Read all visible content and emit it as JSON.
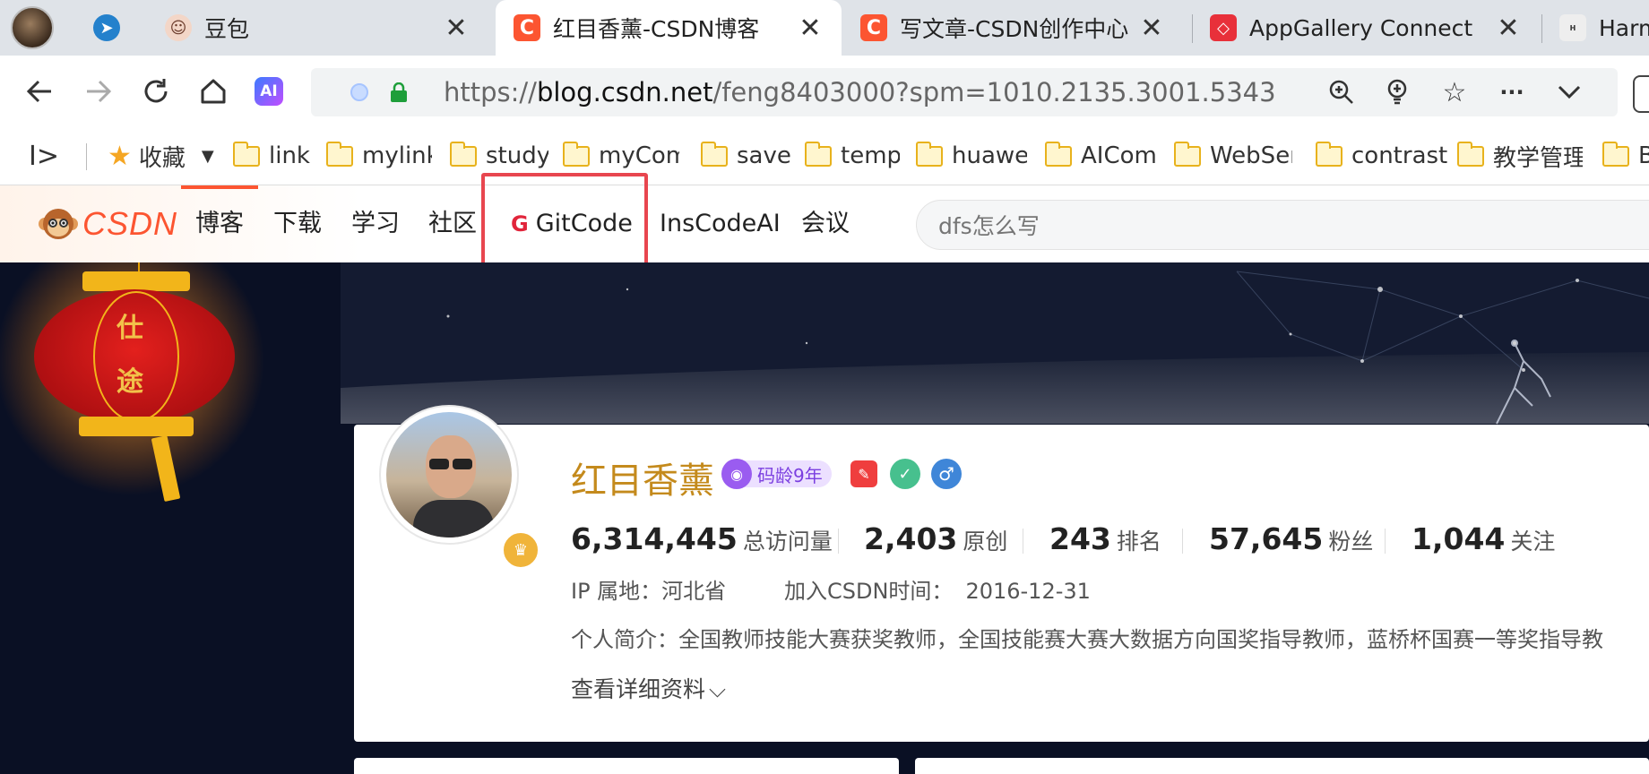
{
  "tabs": [
    {
      "title": "",
      "favicon": "profile-avatar-icon"
    },
    {
      "title": "",
      "favicon": "telegram-icon"
    },
    {
      "title": "豆包",
      "favicon": "doubao-icon"
    },
    {
      "title": "红目香薰-CSDN博客",
      "favicon": "csdn-icon",
      "active": true
    },
    {
      "title": "写文章-CSDN创作中心",
      "favicon": "csdn-icon"
    },
    {
      "title": "AppGallery Connect",
      "favicon": "appgallery-icon"
    },
    {
      "title": "Harm",
      "favicon": "harmonyos-icon"
    }
  ],
  "address_bar": {
    "scheme": "https://",
    "domain": "blog.csdn.net",
    "path": "/feng8403000?spm=1010.2135.3001.5343"
  },
  "bookmarks": {
    "favorites_label": "收藏",
    "items": [
      "link",
      "mylink",
      "study",
      "myCom",
      "save",
      "temp",
      "huawei",
      "AICom",
      "WebSer",
      "contrast",
      "教学管理",
      "B"
    ]
  },
  "csdn_nav": {
    "logo": "CSDN",
    "items": [
      "博客",
      "下载",
      "学习",
      "社区",
      "GitCode",
      "InsCodeAI",
      "会议"
    ],
    "search_placeholder": "dfs怎么写"
  },
  "lantern_text": [
    "仕",
    "途"
  ],
  "profile": {
    "name": "红目香薰",
    "code_age_badge": "码龄9年",
    "stats": [
      {
        "value": "6,314,445",
        "label": "总访问量"
      },
      {
        "value": "2,403",
        "label": "原创"
      },
      {
        "value": "243",
        "label": "排名"
      },
      {
        "value": "57,645",
        "label": "粉丝"
      },
      {
        "value": "1,044",
        "label": "关注"
      }
    ],
    "ip_location": "IP 属地：河北省",
    "join_label": "加入CSDN时间：",
    "join_date": "2016-12-31",
    "bio": "个人简介：全国教师技能大赛获奖教师，全国技能赛大赛大数据方向国奖指导教师，蓝桥杯国赛一等奖指导教",
    "more_info": "查看详细资料"
  },
  "colors": {
    "csdn_red": "#fc5531",
    "highlight_box": "#e8464f",
    "name_color": "#c48a1c"
  }
}
